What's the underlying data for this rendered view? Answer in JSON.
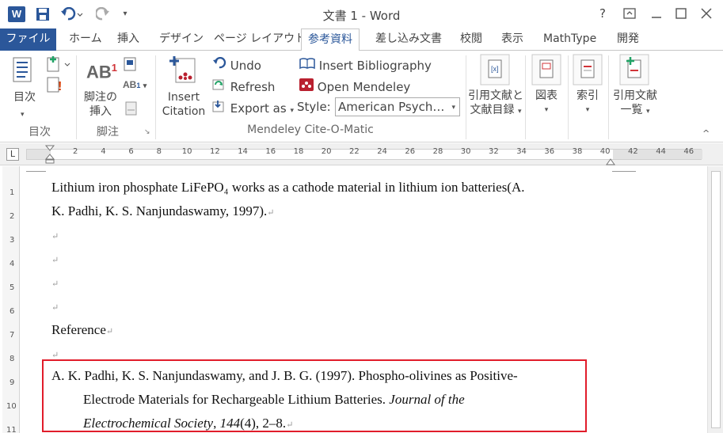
{
  "title_bar": {
    "app_icon": "W",
    "title": "文書 1 - Word",
    "help": "?",
    "qat_icons": [
      "save-icon",
      "undo-icon",
      "redo-icon",
      "customize-icon"
    ]
  },
  "tabs": [
    {
      "label": "ファイル"
    },
    {
      "label": "ホーム"
    },
    {
      "label": "挿入"
    },
    {
      "label": "デザイン"
    },
    {
      "label": "ページ レイアウト"
    },
    {
      "label": "参考資料"
    },
    {
      "label": "差し込み文書"
    },
    {
      "label": "校閲"
    },
    {
      "label": "表示"
    },
    {
      "label": "MathType"
    },
    {
      "label": "開発"
    }
  ],
  "ribbon": {
    "toc": {
      "label": "目次",
      "group": "目次"
    },
    "footnote": {
      "label_line1": "脚注の",
      "label_line2": "挿入",
      "group": "脚注",
      "ab_text": "AB",
      "sup": "1"
    },
    "mendeley": {
      "insert_citation_line1": "Insert",
      "insert_citation_line2": "Citation",
      "undo": "Undo",
      "refresh": "Refresh",
      "export_as": "Export as",
      "insert_bibliography": "Insert Bibliography",
      "open_mendeley": "Open Mendeley",
      "style_label": "Style:",
      "style_value": "American Psych…",
      "group": "Mendeley Cite-O-Matic"
    },
    "citations": {
      "label_line1": "引用文献と",
      "label_line2": "文献目録"
    },
    "captions": {
      "label": "図表"
    },
    "index": {
      "label": "索引"
    },
    "toa": {
      "label_line1": "引用文献",
      "label_line2": "一覧"
    }
  },
  "ruler": {
    "numbers": [
      "2",
      "4",
      "6",
      "8",
      "10",
      "12",
      "14",
      "16",
      "18",
      "20",
      "22",
      "24",
      "26",
      "28",
      "30",
      "32",
      "34",
      "36",
      "38",
      "40",
      "42",
      "44",
      "46"
    ],
    "vnumbers": [
      "1",
      "2",
      "3",
      "4",
      "5",
      "6",
      "7",
      "8",
      "9",
      "10",
      "11"
    ]
  },
  "document": {
    "para1_line1": "Lithium iron phosphate LiFePO₄ works as a cathode material in lithium ion batteries(A.",
    "para1_line2": "K. Padhi, K. S. Nanjundaswamy, 1997).",
    "heading": "Reference",
    "ref_line1": "A. K. Padhi, K. S. Nanjundaswamy, and J. B. G. (1997). Phospho-olivines as Positive-",
    "ref_line2_plain": "Electrode Materials for Rechargeable Lithium Batteries. ",
    "ref_line2_italic": "Journal of the",
    "ref_line3_italic1": "Electrochemical Society",
    "ref_line3_mid": ", ",
    "ref_line3_italic2": "144",
    "ref_line3_end": "(4), 2–8.",
    "para_mark": "↵"
  },
  "colors": {
    "accent": "#2b579a",
    "highlight_box": "#e11c2a",
    "mendeley_red": "#b9202f"
  }
}
